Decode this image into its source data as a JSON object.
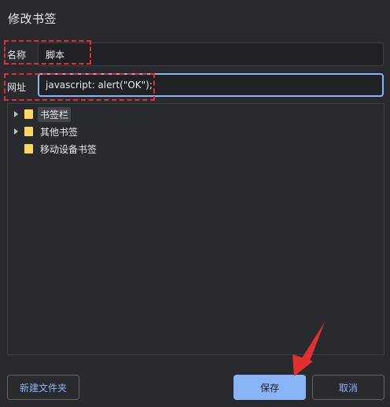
{
  "dialog": {
    "title": "修改书签"
  },
  "name_field": {
    "label": "名称",
    "value": "脚本"
  },
  "url_field": {
    "label": "网址",
    "value": "javascript: alert(\"OK\");"
  },
  "tree": {
    "items": [
      {
        "label": "书签栏",
        "expandable": true,
        "selected": true
      },
      {
        "label": "其他书签",
        "expandable": true,
        "selected": false
      },
      {
        "label": "移动设备书签",
        "expandable": false,
        "selected": false
      }
    ]
  },
  "buttons": {
    "new_folder": "新建文件夹",
    "save": "保存",
    "cancel": "取消"
  },
  "colors": {
    "background": "#292a2d",
    "accent": "#8ab4f8",
    "folder": "#fdd663",
    "annotation": "#e03030"
  },
  "icons": {
    "folder": "folder-icon",
    "expand": "chevron-right-icon",
    "annotation_arrow": "pointer-arrow-icon"
  }
}
